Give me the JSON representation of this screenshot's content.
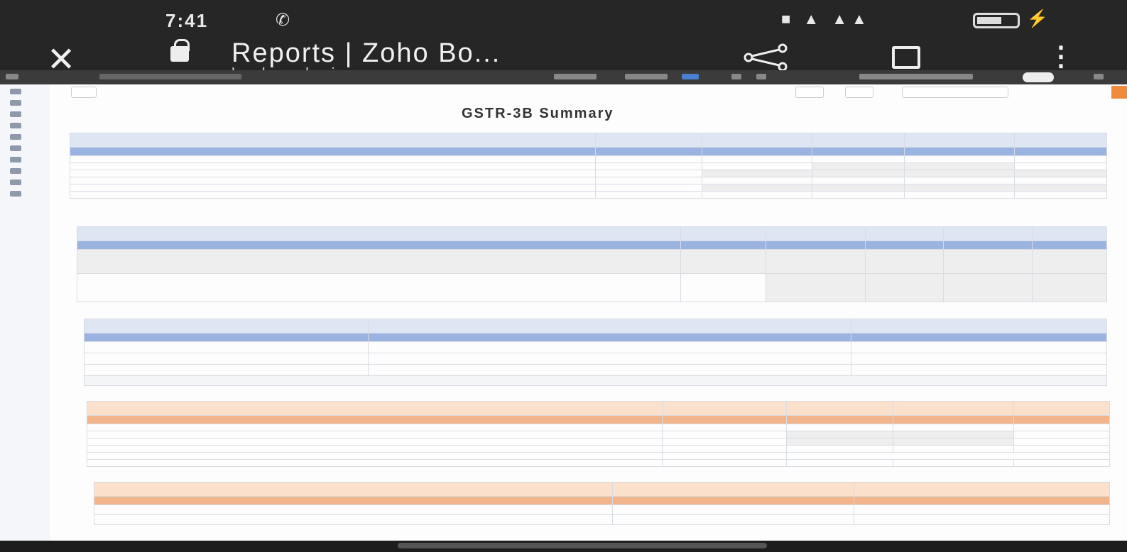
{
  "status_bar": {
    "time": "7:41"
  },
  "browser": {
    "title": "Reports | Zoho Bo...",
    "url": "books.zoho.in"
  },
  "report": {
    "title": "GSTR-3B Summary"
  }
}
